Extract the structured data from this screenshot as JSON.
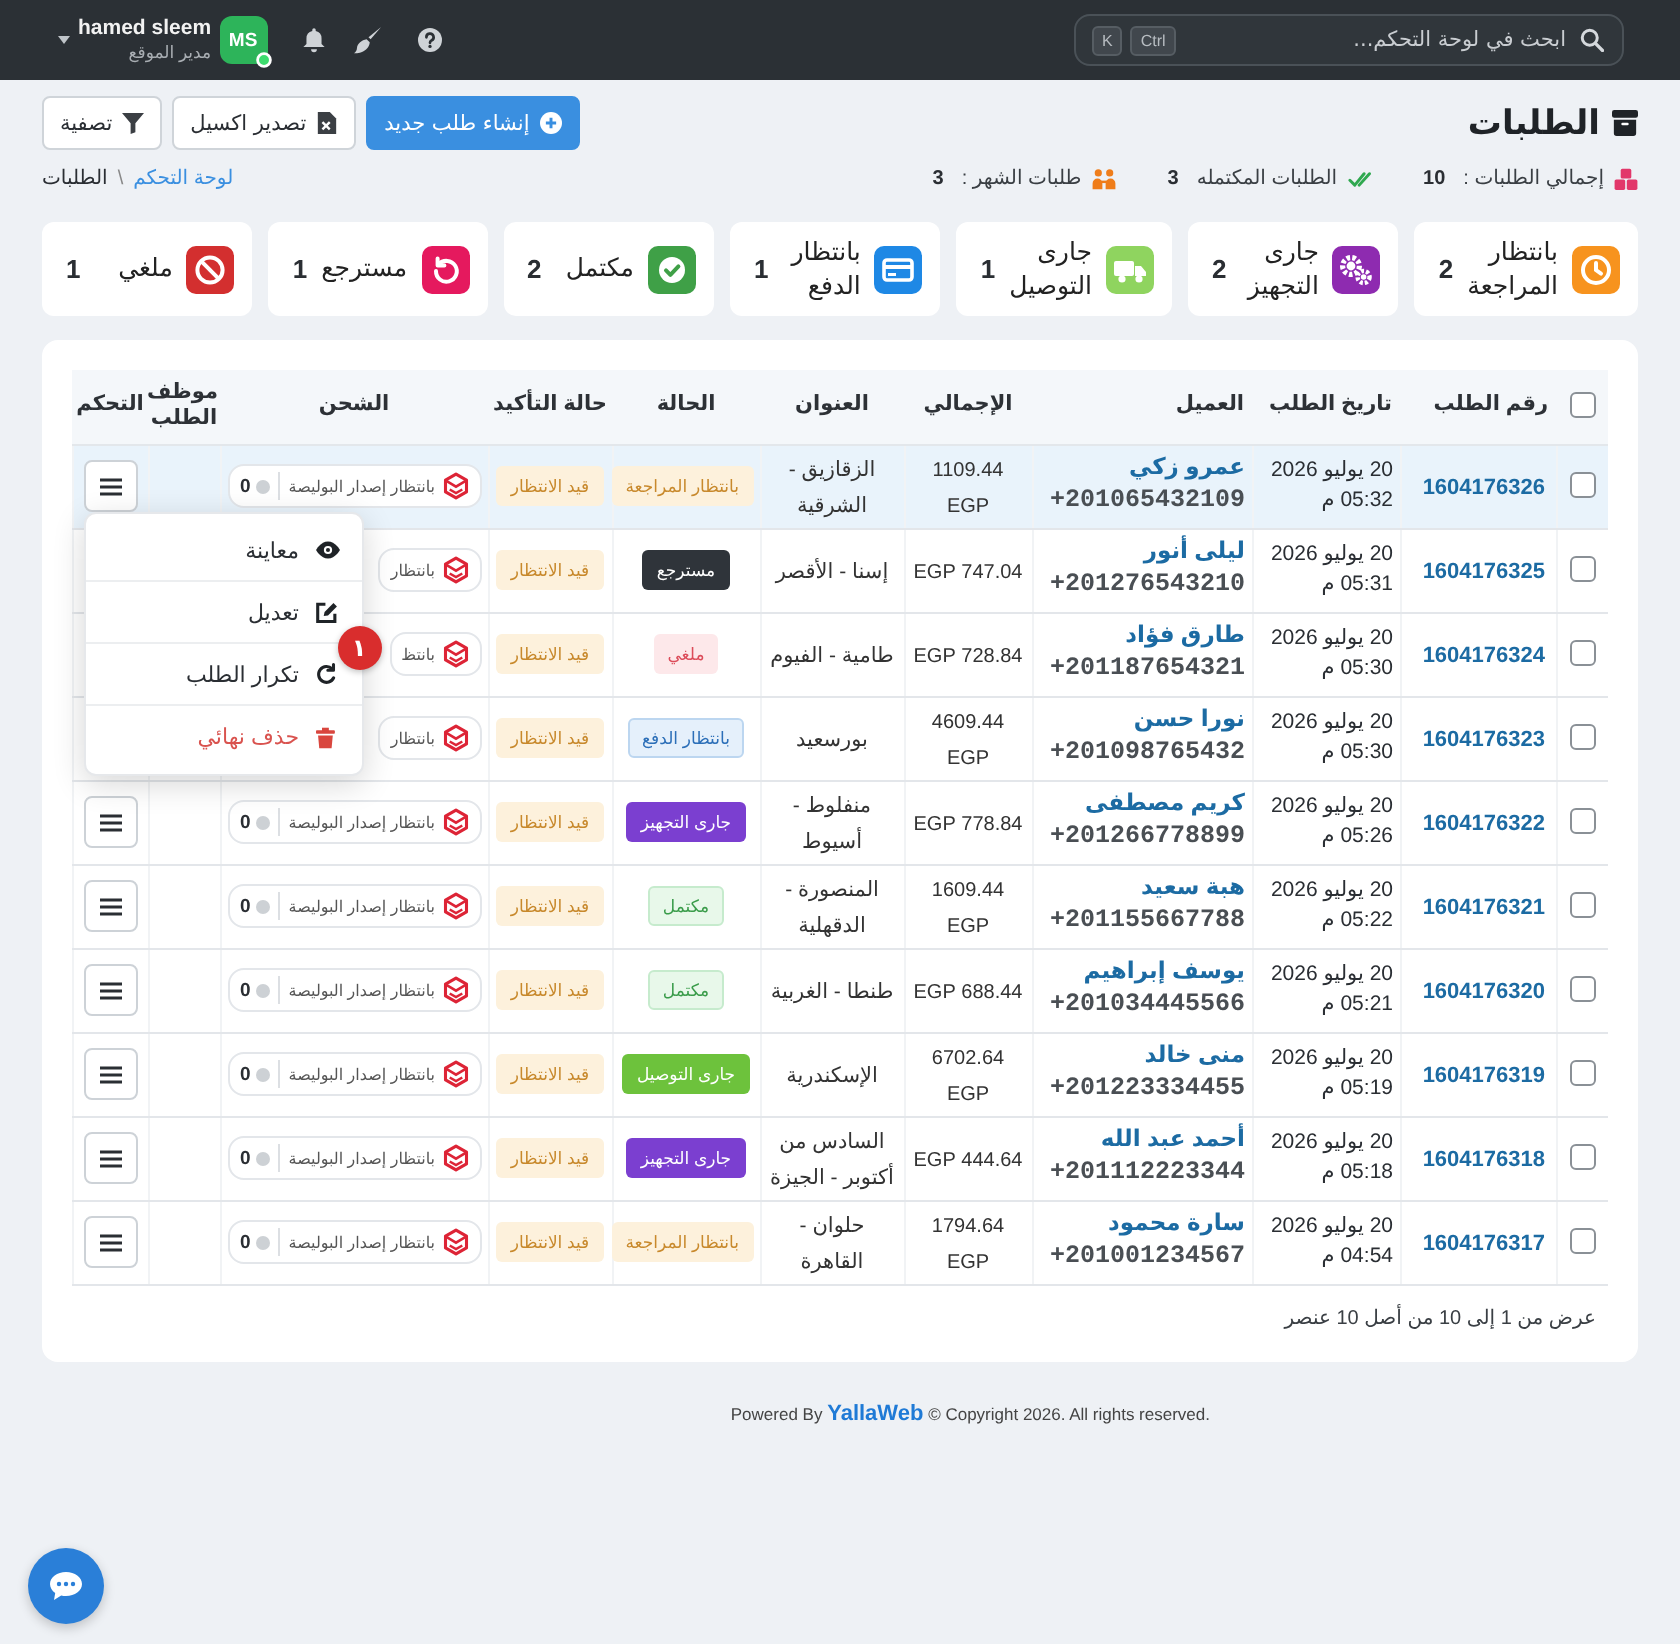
{
  "topbar": {
    "search": {
      "placeholder": "ابحث في لوحة التحكم...",
      "keys": [
        "Ctrl",
        "K"
      ]
    },
    "user": {
      "name": "hamed sleem",
      "role": "مدير الموقع",
      "initials": "MS",
      "online": true
    }
  },
  "header": {
    "title": "الطلبات",
    "buttons": [
      {
        "label": "إنشاء طلب جديد",
        "kind": "create"
      },
      {
        "label": "تصدير اكسيل",
        "kind": "export"
      },
      {
        "label": "تصفية",
        "kind": "filter"
      }
    ],
    "stats": [
      {
        "label": "إجمالي الطلبات :",
        "value": "10",
        "kind": "total"
      },
      {
        "label": "الطلبات المكتمله",
        "value": "3",
        "kind": "completed"
      },
      {
        "label": "طلبات الشهر :",
        "value": "3",
        "kind": "month"
      }
    ],
    "breadcrumb": {
      "items": [
        {
          "label": "لوحة التحكم",
          "current": false
        },
        {
          "label": "الطلبات",
          "current": true
        }
      ],
      "separator": "\\"
    }
  },
  "status_cards": [
    {
      "label": "بانتظار المراجعة",
      "count": "2",
      "kind": "review",
      "color": "#f7931e"
    },
    {
      "label": "جارى التجهيز",
      "count": "2",
      "kind": "preparing",
      "color": "#8e2bb0"
    },
    {
      "label": "جارى التوصيل",
      "count": "1",
      "kind": "delivering",
      "color": "#8fd45f"
    },
    {
      "label": "بانتظار الدفع",
      "count": "1",
      "kind": "payment",
      "color": "#1e88e5"
    },
    {
      "label": "مكتمل",
      "count": "2",
      "kind": "completed",
      "color": "#3fa047"
    },
    {
      "label": "مسترجع",
      "count": "1",
      "kind": "returned",
      "color": "#e5195e"
    },
    {
      "label": "ملغي",
      "count": "1",
      "kind": "cancelled",
      "color": "#d32f2f"
    }
  ],
  "table": {
    "select_all": {
      "checked": false
    },
    "columns": [
      "رقم الطلب",
      "تاريخ الطلب",
      "العميل",
      "الإجمالي",
      "العنوان",
      "الحالة",
      "حالة التأكيد",
      "الشحن",
      "موظف الطلب",
      "التحكم"
    ],
    "rows": [
      {
        "checked": false,
        "highlighted": true,
        "order_no": "1604176326",
        "date": "20 يوليو 2026",
        "time": "05:32 م",
        "customer": "عمرو زكي",
        "phone": "+201065432109",
        "total": "1109.44 EGP",
        "address": "الزقازيق - الشرقية",
        "status": {
          "label": "بانتظار المراجعة",
          "kind": "review"
        },
        "confirmation": {
          "label": "قيد الانتظار",
          "kind": "pending"
        },
        "shipping": {
          "label": "بانتظار إصدار البوليصة",
          "count": "0"
        },
        "menu_button": true,
        "menu_open": true
      },
      {
        "checked": false,
        "highlighted": false,
        "order_no": "1604176325",
        "date": "20 يوليو 2026",
        "time": "05:31 م",
        "customer": "ليلى أنور",
        "phone": "+201276543210",
        "total": "747.04 EGP",
        "address": "إسنا - الأقصر",
        "status": {
          "label": "مسترجع",
          "kind": "returned"
        },
        "confirmation": {
          "label": "قيد الانتظار",
          "kind": "pending"
        },
        "shipping": {
          "label": "بانتظار"
        },
        "menu_button": false,
        "menu_open": false
      },
      {
        "checked": false,
        "highlighted": false,
        "order_no": "1604176324",
        "date": "20 يوليو 2026",
        "time": "05:30 م",
        "customer": "طارق فؤاد",
        "phone": "+201187654321",
        "total": "728.84 EGP",
        "address": "طامية - الفيوم",
        "status": {
          "label": "ملغي",
          "kind": "cancelled"
        },
        "confirmation": {
          "label": "قيد الانتظار",
          "kind": "pending"
        },
        "shipping": {
          "label": "بانتظ"
        },
        "menu_button": false,
        "menu_open": false
      },
      {
        "checked": false,
        "highlighted": false,
        "order_no": "1604176323",
        "date": "20 يوليو 2026",
        "time": "05:30 م",
        "customer": "نورا حسن",
        "phone": "+201098765432",
        "total": "4609.44 EGP",
        "address": "بورسعيد",
        "status": {
          "label": "بانتظار الدفع",
          "kind": "payment"
        },
        "confirmation": {
          "label": "قيد الانتظار",
          "kind": "pending"
        },
        "shipping": {
          "label": "بانتظار"
        },
        "menu_button": false,
        "menu_open": false
      },
      {
        "checked": false,
        "highlighted": false,
        "order_no": "1604176322",
        "date": "20 يوليو 2026",
        "time": "05:26 م",
        "customer": "كريم مصطفى",
        "phone": "+201266778899",
        "total": "778.84 EGP",
        "address": "منفلوط - أسيوط",
        "status": {
          "label": "جارى التجهيز",
          "kind": "preparing"
        },
        "confirmation": {
          "label": "قيد الانتظار",
          "kind": "pending"
        },
        "shipping": {
          "label": "بانتظار إصدار البوليصة",
          "count": "0"
        },
        "menu_button": true,
        "menu_open": false
      },
      {
        "checked": false,
        "highlighted": false,
        "order_no": "1604176321",
        "date": "20 يوليو 2026",
        "time": "05:22 م",
        "customer": "هبة سعيد",
        "phone": "+201155667788",
        "total": "1609.44 EGP",
        "address": "المنصورة - الدقهلية",
        "status": {
          "label": "مكتمل",
          "kind": "completed"
        },
        "confirmation": {
          "label": "قيد الانتظار",
          "kind": "pending"
        },
        "shipping": {
          "label": "بانتظار إصدار البوليصة",
          "count": "0"
        },
        "menu_button": true,
        "menu_open": false
      },
      {
        "checked": false,
        "highlighted": false,
        "order_no": "1604176320",
        "date": "20 يوليو 2026",
        "time": "05:21 م",
        "customer": "يوسف إبراهيم",
        "phone": "+201034445566",
        "total": "688.44 EGP",
        "address": "طنطا - الغربية",
        "status": {
          "label": "مكتمل",
          "kind": "completed"
        },
        "confirmation": {
          "label": "قيد الانتظار",
          "kind": "pending"
        },
        "shipping": {
          "label": "بانتظار إصدار البوليصة",
          "count": "0"
        },
        "menu_button": true,
        "menu_open": false
      },
      {
        "checked": false,
        "highlighted": false,
        "order_no": "1604176319",
        "date": "20 يوليو 2026",
        "time": "05:19 م",
        "customer": "منى خالد",
        "phone": "+201223334455",
        "total": "6702.64 EGP",
        "address": "الإسكندرية",
        "status": {
          "label": "جارى التوصيل",
          "kind": "delivering"
        },
        "confirmation": {
          "label": "قيد الانتظار",
          "kind": "pending"
        },
        "shipping": {
          "label": "بانتظار إصدار البوليصة",
          "count": "0"
        },
        "menu_button": true,
        "menu_open": false
      },
      {
        "checked": false,
        "highlighted": false,
        "order_no": "1604176318",
        "date": "20 يوليو 2026",
        "time": "05:18 م",
        "customer": "أحمد عبد الله",
        "phone": "+201112223344",
        "total": "444.64 EGP",
        "address": "السادس من أكتوبر - الجيزة",
        "status": {
          "label": "جارى التجهيز",
          "kind": "preparing"
        },
        "confirmation": {
          "label": "قيد الانتظار",
          "kind": "pending"
        },
        "shipping": {
          "label": "بانتظار إصدار البوليصة",
          "count": "0"
        },
        "menu_button": true,
        "menu_open": false
      },
      {
        "checked": false,
        "highlighted": false,
        "order_no": "1604176317",
        "date": "20 يوليو 2026",
        "time": "04:54 م",
        "customer": "سارة محمود",
        "phone": "+201001234567",
        "total": "1794.64 EGP",
        "address": "حلوان - القاهرة",
        "status": {
          "label": "بانتظار المراجعة",
          "kind": "review"
        },
        "confirmation": {
          "label": "قيد الانتظار",
          "kind": "pending"
        },
        "shipping": {
          "label": "بانتظار إصدار البوليصة",
          "count": "0"
        },
        "menu_button": true,
        "menu_open": false
      }
    ],
    "info": "عرض من 1 إلى 10 من أصل 10 عنصر"
  },
  "row_menu": {
    "items": [
      {
        "label": "معاينة",
        "kind": "view"
      },
      {
        "label": "تعديل",
        "kind": "edit"
      },
      {
        "label": "تكرار الطلب",
        "kind": "repeat",
        "marker": "١"
      },
      {
        "label": "حذف نهائي",
        "kind": "delete"
      }
    ]
  },
  "footer": {
    "prefix": "Powered By",
    "brand": "YallaWeb",
    "suffix": "© Copyright 2026. All rights reserved."
  }
}
